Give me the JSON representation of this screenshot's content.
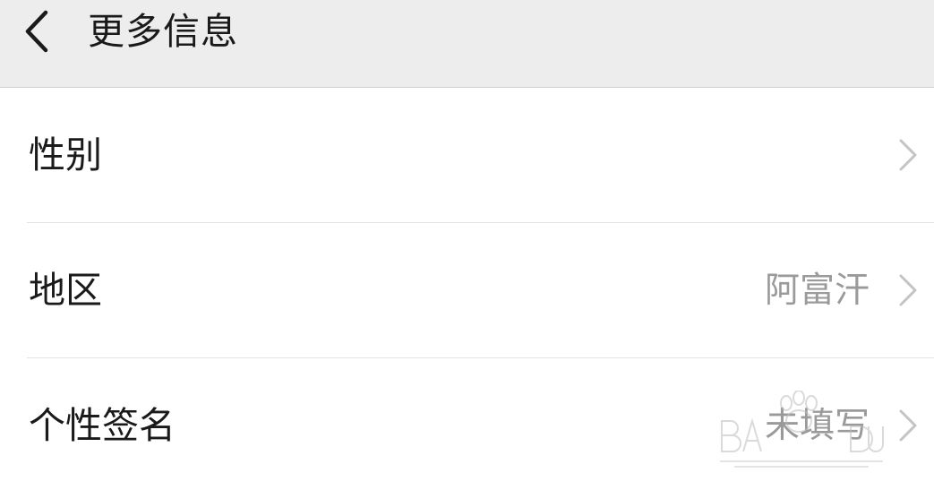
{
  "header": {
    "title": "更多信息",
    "back_icon": "chevron-left-icon"
  },
  "rows": [
    {
      "label": "性别",
      "value": ""
    },
    {
      "label": "地区",
      "value": "阿富汗"
    },
    {
      "label": "个性签名",
      "value": "未填写"
    }
  ],
  "colors": {
    "header_bg": "#ededed",
    "label_text": "#1a1a1a",
    "value_text": "#9a9a9a",
    "chevron": "#c4c4c4",
    "divider": "#e2e2e2"
  }
}
